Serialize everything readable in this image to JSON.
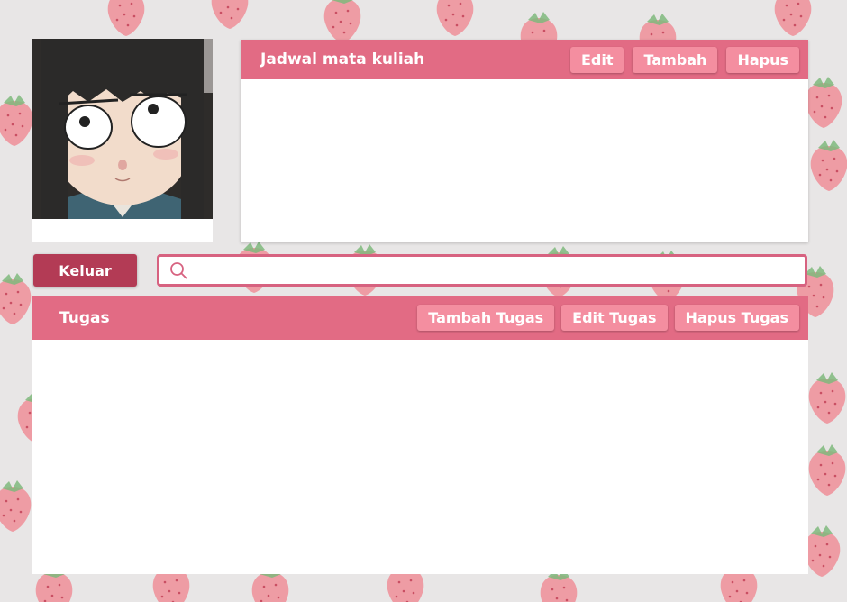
{
  "theme": {
    "header_pink": "#e26b84",
    "button_pink": "#f48ea0",
    "logout_red": "#b33b55",
    "search_border": "#d76280",
    "background": "#e8e6e6"
  },
  "schedule": {
    "title": "Jadwal mata kuliah",
    "buttons": [
      "Edit",
      "Tambah",
      "Hapus"
    ]
  },
  "logout_label": "Keluar",
  "search": {
    "value": "",
    "placeholder": "",
    "icon": "search-icon"
  },
  "tasks": {
    "title": "Tugas",
    "buttons": [
      "Tambah Tugas",
      "Edit Tugas",
      "Hapus Tugas"
    ]
  }
}
